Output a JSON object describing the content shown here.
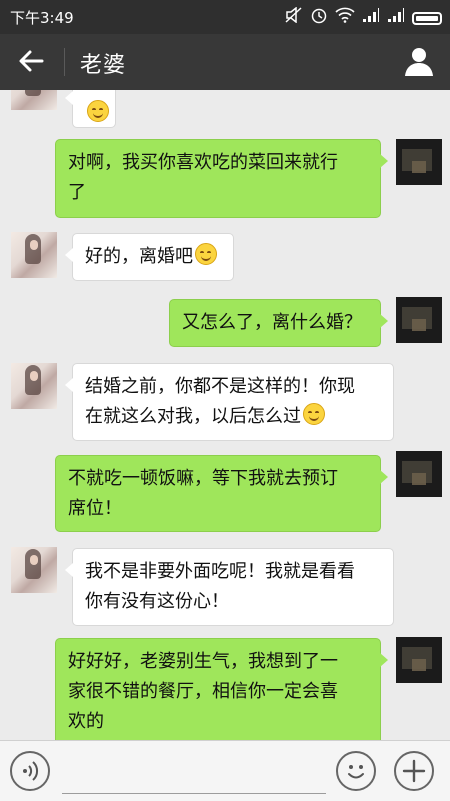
{
  "status_bar": {
    "time": "下午3:49",
    "icons": [
      "mute-icon",
      "alarm-icon",
      "wifi-icon",
      "signal-icon",
      "signal-icon",
      "battery-icon"
    ]
  },
  "header": {
    "title": "老婆",
    "back_icon": "arrow-left-icon",
    "profile_icon": "person-icon"
  },
  "messages": [
    {
      "from": "friend",
      "text": "",
      "emoji": true,
      "partial": true
    },
    {
      "from": "me",
      "lines": [
        "对啊，我买你喜欢吃的菜回来就行",
        "了"
      ]
    },
    {
      "from": "friend",
      "lines": [
        "好的，离婚吧"
      ],
      "emoji": true
    },
    {
      "from": "me",
      "lines": [
        "又怎么了，离什么婚？"
      ]
    },
    {
      "from": "friend",
      "lines": [
        "结婚之前，你都不是这样的！你现",
        "在就这么对我，以后怎么过"
      ],
      "emoji": true
    },
    {
      "from": "me",
      "lines": [
        "不就吃一顿饭嘛，等下我就去预订",
        "席位！"
      ]
    },
    {
      "from": "friend",
      "lines": [
        "我不是非要外面吃呢！我就是看看",
        "你有没有这份心！"
      ]
    },
    {
      "from": "me",
      "lines": [
        "好好好，老婆别生气，我想到了一",
        "家很不错的餐厅，相信你一定会喜",
        "欢的"
      ]
    }
  ],
  "input_bar": {
    "voice_icon": "voice-icon",
    "input_placeholder": "",
    "emoji_icon": "emoji-icon",
    "plus_icon": "plus-icon"
  }
}
